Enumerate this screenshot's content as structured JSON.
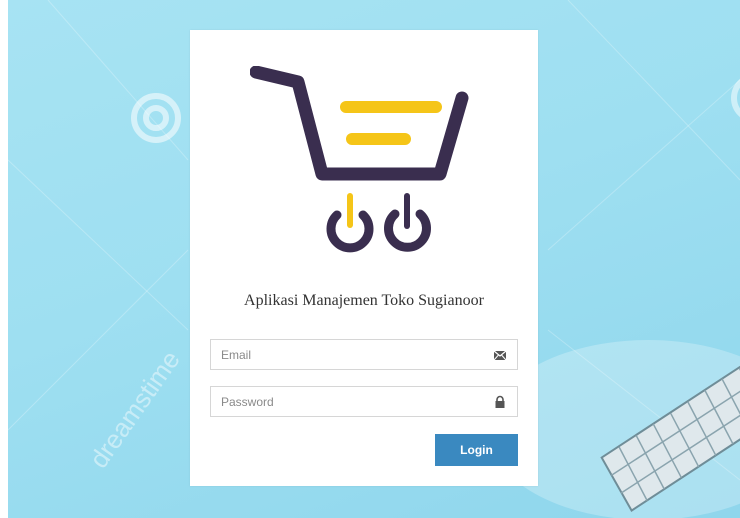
{
  "app": {
    "title": "Aplikasi Manajemen Toko Sugianoor"
  },
  "form": {
    "email": {
      "placeholder": "Email",
      "value": ""
    },
    "password": {
      "placeholder": "Password",
      "value": ""
    },
    "login_label": "Login"
  },
  "background": {
    "watermark": "dreamstime"
  },
  "icons": {
    "email": "envelope-icon",
    "password": "lock-icon",
    "logo": "shopping-cart-logo"
  },
  "colors": {
    "background": "#9edff1",
    "card": "#ffffff",
    "button": "#3a89c0",
    "logo_dark": "#3a2e4f",
    "logo_yellow": "#f5c518"
  }
}
